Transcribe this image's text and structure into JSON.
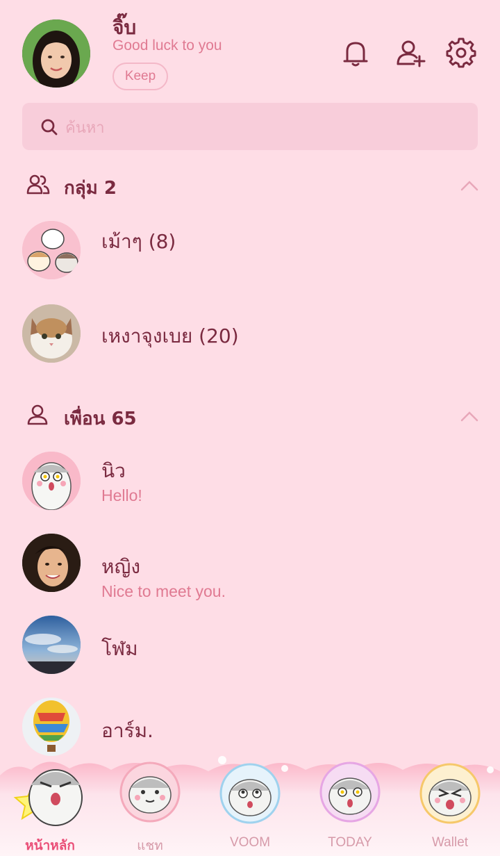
{
  "profile": {
    "name": "จิ๊บ",
    "status": "Good luck to you",
    "keep_label": "Keep"
  },
  "header_icons": [
    "bell-icon",
    "add-friend-icon",
    "settings-icon"
  ],
  "search": {
    "placeholder": "ค้นหา"
  },
  "groups": {
    "title": "กลุ่ม 2",
    "items": [
      {
        "name": "เม้าๆ (8)"
      },
      {
        "name": "เหงาจุงเบย (20)"
      }
    ]
  },
  "friends": {
    "title": "เพื่อน 65",
    "items": [
      {
        "name": "นิว",
        "message": "Hello!"
      },
      {
        "name": "หญิง",
        "message": "Nice to meet you."
      },
      {
        "name": "โฬม",
        "message": ""
      },
      {
        "name": "อาร์ม.",
        "message": ""
      }
    ]
  },
  "tabs": [
    {
      "label": "หน้าหลัก",
      "active": true
    },
    {
      "label": "แชท",
      "active": false
    },
    {
      "label": "VOOM",
      "active": false
    },
    {
      "label": "TODAY",
      "active": false
    },
    {
      "label": "Wallet",
      "active": false
    }
  ],
  "colors": {
    "background": "#fedde6",
    "text_primary": "#7a2a40",
    "text_secondary": "#e07a92",
    "search_bg": "#f8cdda",
    "active_tab": "#ea4f78"
  }
}
